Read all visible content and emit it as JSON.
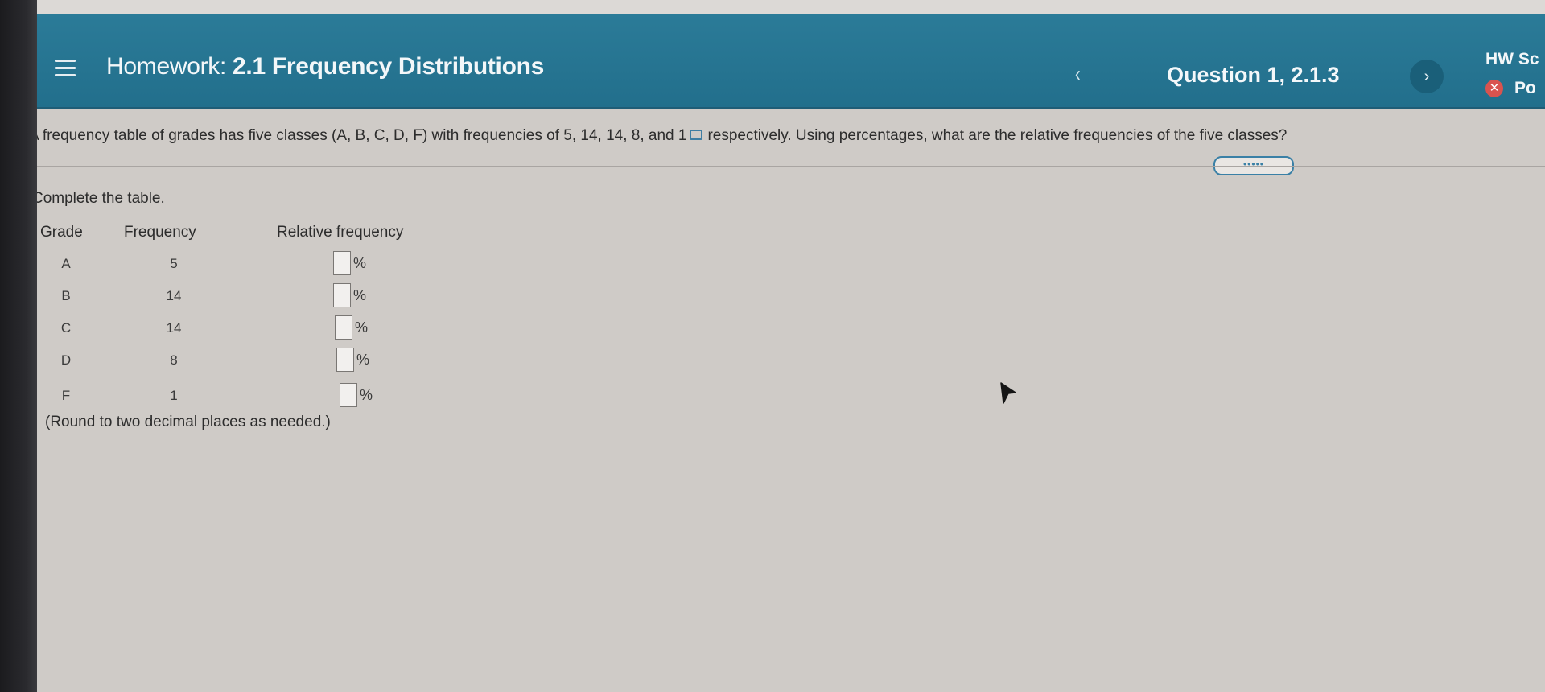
{
  "header": {
    "homework_prefix": "Homework:",
    "homework_title": "2.1 Frequency Distributions",
    "question_label": "Question 1, 2.1.3",
    "prev_icon": "chevron-left-icon",
    "next_icon": "chevron-right-icon",
    "hw_score_label": "HW Sc",
    "points_label": "Po"
  },
  "question": {
    "prompt_part1": "A frequency table of grades has five classes (A, B, C, D, F) with frequencies of 5, 14, 14, 8, and 1",
    "prompt_part2": "respectively. Using percentages, what are the relative frequencies of the five classes?",
    "instruction": "Complete the table.",
    "round_note": "(Round to two decimal places as needed.)"
  },
  "table": {
    "headers": [
      "Grade",
      "Frequency",
      "Relative frequency"
    ],
    "percent_symbol": "%",
    "rows": [
      {
        "grade": "A",
        "frequency": "5",
        "relative_frequency": ""
      },
      {
        "grade": "B",
        "frequency": "14",
        "relative_frequency": ""
      },
      {
        "grade": "C",
        "frequency": "14",
        "relative_frequency": ""
      },
      {
        "grade": "D",
        "frequency": "8",
        "relative_frequency": ""
      },
      {
        "grade": "F",
        "frequency": "1",
        "relative_frequency": ""
      }
    ]
  },
  "colors": {
    "header_bg": "#2b7b98",
    "accent": "#3a80a6",
    "error": "#d9534f",
    "page_bg": "#cfcbc7"
  }
}
